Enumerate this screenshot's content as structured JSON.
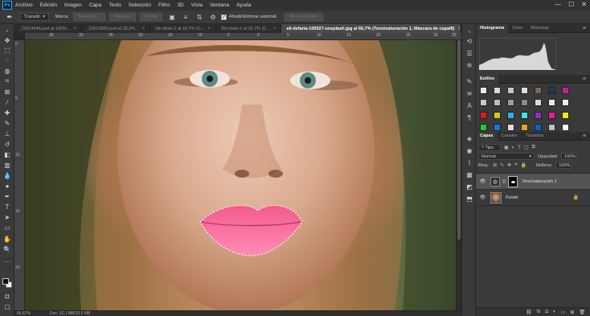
{
  "app": {
    "logo": "Ps"
  },
  "menubar": {
    "items": [
      "Archivo",
      "Edición",
      "Imagen",
      "Capa",
      "Texto",
      "Selección",
      "Filtro",
      "3D",
      "Vista",
      "Ventana",
      "Ayuda"
    ]
  },
  "window_controls": {
    "minimize": "—",
    "maximize": "☐",
    "close": "✕"
  },
  "options": {
    "mode": "Trazado",
    "make_label": "Marca:",
    "seleccion_btn": "Selección...",
    "mascara_btn": "Máscara",
    "forma_btn": "Forma",
    "auto_add_label": "Añadir/Eliminar automát.",
    "align_edges_label": "Alinear bordes"
  },
  "tabs": [
    "_DSC4645.psd al 100%...",
    "_DSC4353.psd al 33,3%...",
    "Sin título-1 al 16,7% (C...",
    "Sin título-2 al 16,7% (C...",
    "eli-defaria-100527-unsplash.jpg al 66,7% (Tono/saturación 1, Máscara de capa/8)"
  ],
  "ruler": {
    "top": [
      "35",
      "30",
      "25",
      "20",
      "15",
      "10",
      "5",
      "0",
      "5",
      "10",
      "15",
      "20",
      "25",
      "30",
      "35"
    ],
    "left": [
      "0",
      "5",
      "10",
      "15",
      "20"
    ]
  },
  "status": {
    "zoom": "66,67%",
    "doc": "Doc: 32,1 MB/33,5 MB"
  },
  "histogram_panel": {
    "tabs": [
      "Histograma",
      "Color",
      "Muestras"
    ]
  },
  "styles_panel": {
    "title": "Estilos"
  },
  "swatch_colors": [
    "#e8e8e8",
    "#d9d9d9",
    "#c8c8c8",
    "#e6dccf",
    "#7a6a58",
    "#1a3a5a",
    "#cc1e8c",
    "#c9c9c9",
    "#bdbdbd",
    "#9c9c9c",
    "#8a8a8a",
    "#dcdcdc",
    "#e6e6e6",
    "#f0f0f0",
    "#e8141e",
    "#d4c81a",
    "#2eb0e6",
    "#3ce6e6",
    "#8c32c8",
    "#e61e96",
    "#f2e618",
    "#20c832",
    "#1878d8",
    "#f0d8e0",
    "#e6a028",
    "#0a64c8",
    "#bfbfbf",
    "#ffffff"
  ],
  "layers_panel": {
    "tabs": [
      "Capas",
      "Canales",
      "Trazados"
    ],
    "kind": "Tipo",
    "blend_mode": "Normal",
    "opacity_label": "Opacidad:",
    "opacity_value": "100%",
    "lock_label": "Bloq.:",
    "fill_label": "Relleno:",
    "fill_value": "100%",
    "layers": [
      {
        "name": "Tono/saturación 1"
      },
      {
        "name": "Fondo"
      }
    ]
  },
  "panel_footer": {
    "link": "⛓",
    "fx": "fx",
    "mask": "◘",
    "adj": "◐",
    "folder": "▭",
    "new": "⊞",
    "trash": "🗑"
  }
}
